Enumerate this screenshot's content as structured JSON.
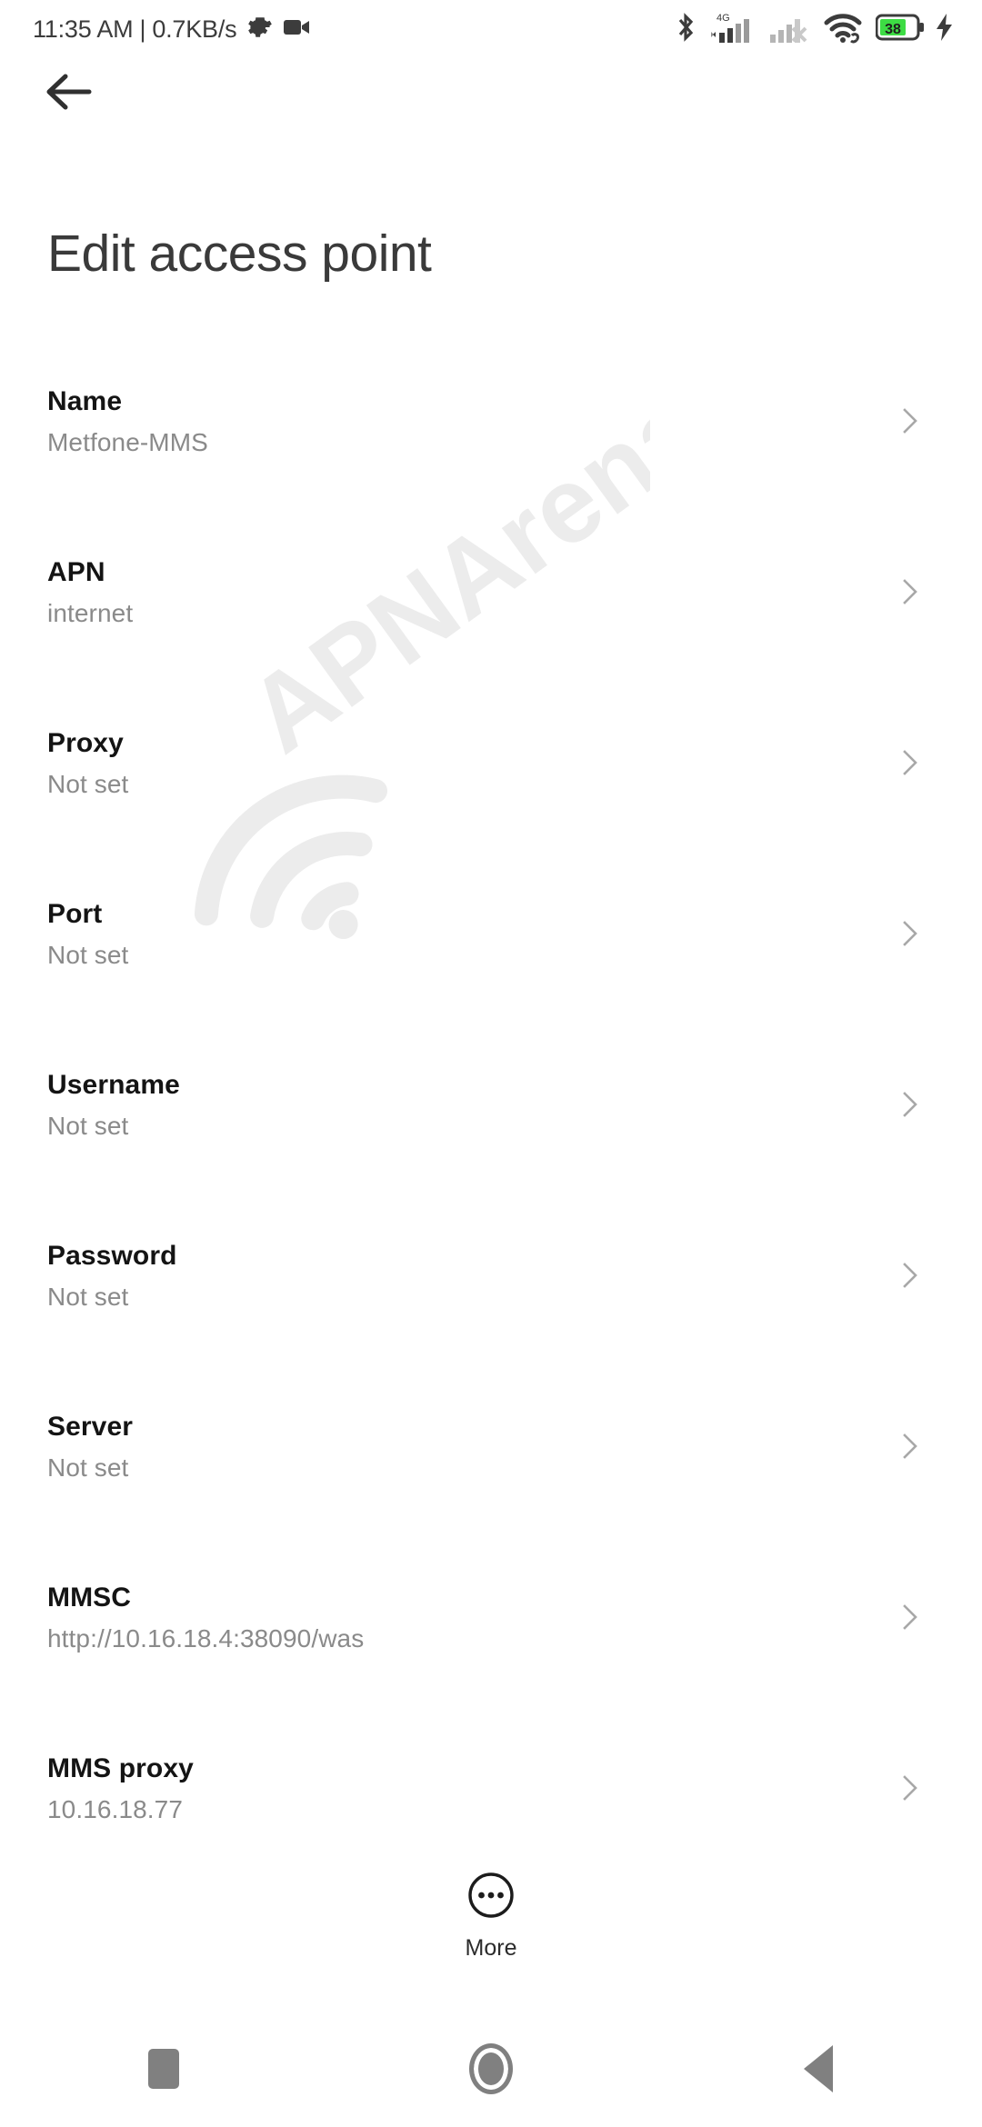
{
  "status_bar": {
    "time": "11:35 AM",
    "separator": "|",
    "network_speed": "0.7KB/s",
    "left_icons": [
      "gear-icon",
      "camcorder-icon"
    ],
    "right_icons": [
      "bluetooth-icon",
      "signal-4g-icon",
      "signal-sim2-off-icon",
      "wifi-link-icon",
      "battery-icon",
      "charging-bolt-icon"
    ],
    "network_type": "4G",
    "battery_percent": "38",
    "battery_color": "#3ddc44"
  },
  "header": {
    "back_icon": "arrow-left-icon",
    "title": "Edit access point"
  },
  "watermark": {
    "text": "APNArena",
    "color": "#ececec"
  },
  "settings": {
    "rows": [
      {
        "label": "Name",
        "value": "Metfone-MMS"
      },
      {
        "label": "APN",
        "value": "internet"
      },
      {
        "label": "Proxy",
        "value": "Not set"
      },
      {
        "label": "Port",
        "value": "Not set"
      },
      {
        "label": "Username",
        "value": "Not set"
      },
      {
        "label": "Password",
        "value": "Not set"
      },
      {
        "label": "Server",
        "value": "Not set"
      },
      {
        "label": "MMSC",
        "value": "http://10.16.18.4:38090/was"
      },
      {
        "label": "MMS proxy",
        "value": "10.16.18.77"
      }
    ],
    "chevron_icon": "chevron-right-icon"
  },
  "more_button": {
    "label": "More",
    "icon": "more-dots-circle-icon"
  },
  "nav_bar": {
    "recents_label": "Recents",
    "home_label": "Home",
    "back_label": "Back"
  }
}
